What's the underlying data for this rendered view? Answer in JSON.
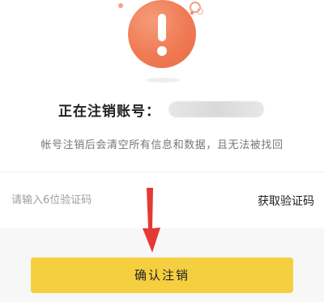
{
  "colors": {
    "warning": "#ef7a54",
    "primary_button": "#f6cf41",
    "annotation_arrow": "#e53935"
  },
  "icons": {
    "warning": "exclamation-icon",
    "annotation": "down-arrow-icon"
  },
  "account": {
    "label": "正在注销账号："
  },
  "hint": "帐号注销后会清空所有信息和数据，且无法被找回",
  "code": {
    "placeholder": "请输入6位验证码",
    "get_code_label": "获取验证码"
  },
  "confirm_label": "确认注销"
}
